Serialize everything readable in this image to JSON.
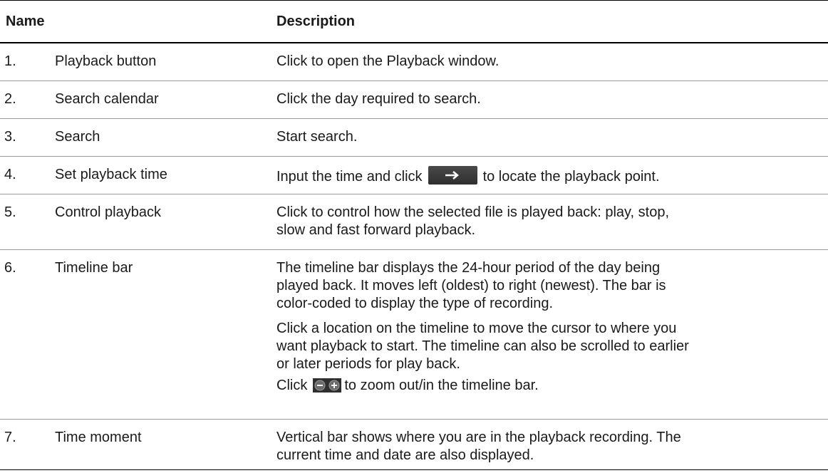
{
  "header": {
    "name": "Name",
    "description": "Description"
  },
  "rows": [
    {
      "num": "1.",
      "name": "Playback button",
      "desc": [
        "Click to open the Playback window."
      ]
    },
    {
      "num": "2.",
      "name": "Search calendar",
      "desc": [
        "Click the day required to search."
      ]
    },
    {
      "num": "3.",
      "name": "Search",
      "desc": [
        "Start search."
      ]
    },
    {
      "num": "4.",
      "name": "Set playback time",
      "desc_before": "Input the time and click",
      "desc_after": "to locate the playback point."
    },
    {
      "num": "5.",
      "name": "Control playback",
      "desc": [
        "Click to control how the selected file is played back:  play, stop,",
        "slow and fast forward playback."
      ]
    },
    {
      "num": "6.",
      "name": "Timeline bar",
      "p1": [
        "The timeline bar displays the 24-hour period of the day being",
        "played back. It moves left (oldest) to right (newest). The bar is",
        "color-coded to display the type of recording."
      ],
      "p2": [
        "Click a location on the timeline to move the cursor to where you",
        "want playback to start. The timeline can also be scrolled to earlier",
        "or later periods for play back."
      ],
      "p3_before": "Click",
      "p3_after": "to zoom out/in the timeline bar."
    },
    {
      "num": "7.",
      "name": "Time moment",
      "desc": [
        "Vertical bar shows where you are in the playback recording. The",
        "current time and date are also displayed."
      ]
    }
  ],
  "icons": {
    "arrow_button": "right-arrow-icon",
    "zoom_buttons": "zoom-out-zoom-in-icon"
  }
}
